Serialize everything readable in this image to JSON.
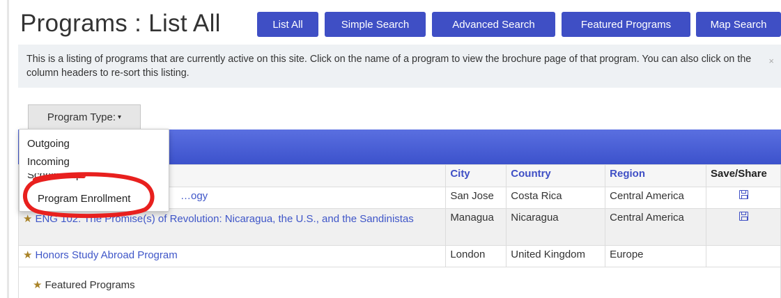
{
  "page": {
    "title": "Programs : List All"
  },
  "nav": {
    "buttons": [
      "List All",
      "Simple Search",
      "Advanced Search",
      "Featured Programs",
      "Map Search"
    ]
  },
  "info": {
    "text": "This is a listing of programs that are currently active on this site. Click on the name of a program to view the brochure page of that program. You can also click on the column headers to re-sort this listing.",
    "close_glyph": "×"
  },
  "filter": {
    "label": "Program Type:",
    "caret": "▾",
    "options": [
      "Outgoing",
      "Incoming",
      "Scholarship",
      "Program Enrollment"
    ]
  },
  "table": {
    "columns": [
      "City",
      "Country",
      "Region",
      "Save/Share"
    ],
    "rows": [
      {
        "name": "…ogy",
        "city": "San Jose",
        "country": "Costa Rica",
        "region": "Central America",
        "save": true,
        "featured": false
      },
      {
        "name": "ENG 102: The Promise(s) of Revolution: Nicaragua, the U.S., and the Sandinistas",
        "city": "Managua",
        "country": "Nicaragua",
        "region": "Central America",
        "save": true,
        "featured": true
      },
      {
        "name": "Honors Study Abroad Program",
        "city": "London",
        "country": "United Kingdom",
        "region": "Europe",
        "save": false,
        "featured": true
      }
    ]
  },
  "legend": {
    "label": "Featured Programs",
    "icon": "★"
  },
  "colors": {
    "accent": "#3f4fc5",
    "highlight": "#f5ef1f",
    "annotation": "#e8201e",
    "star": "#a98328"
  }
}
